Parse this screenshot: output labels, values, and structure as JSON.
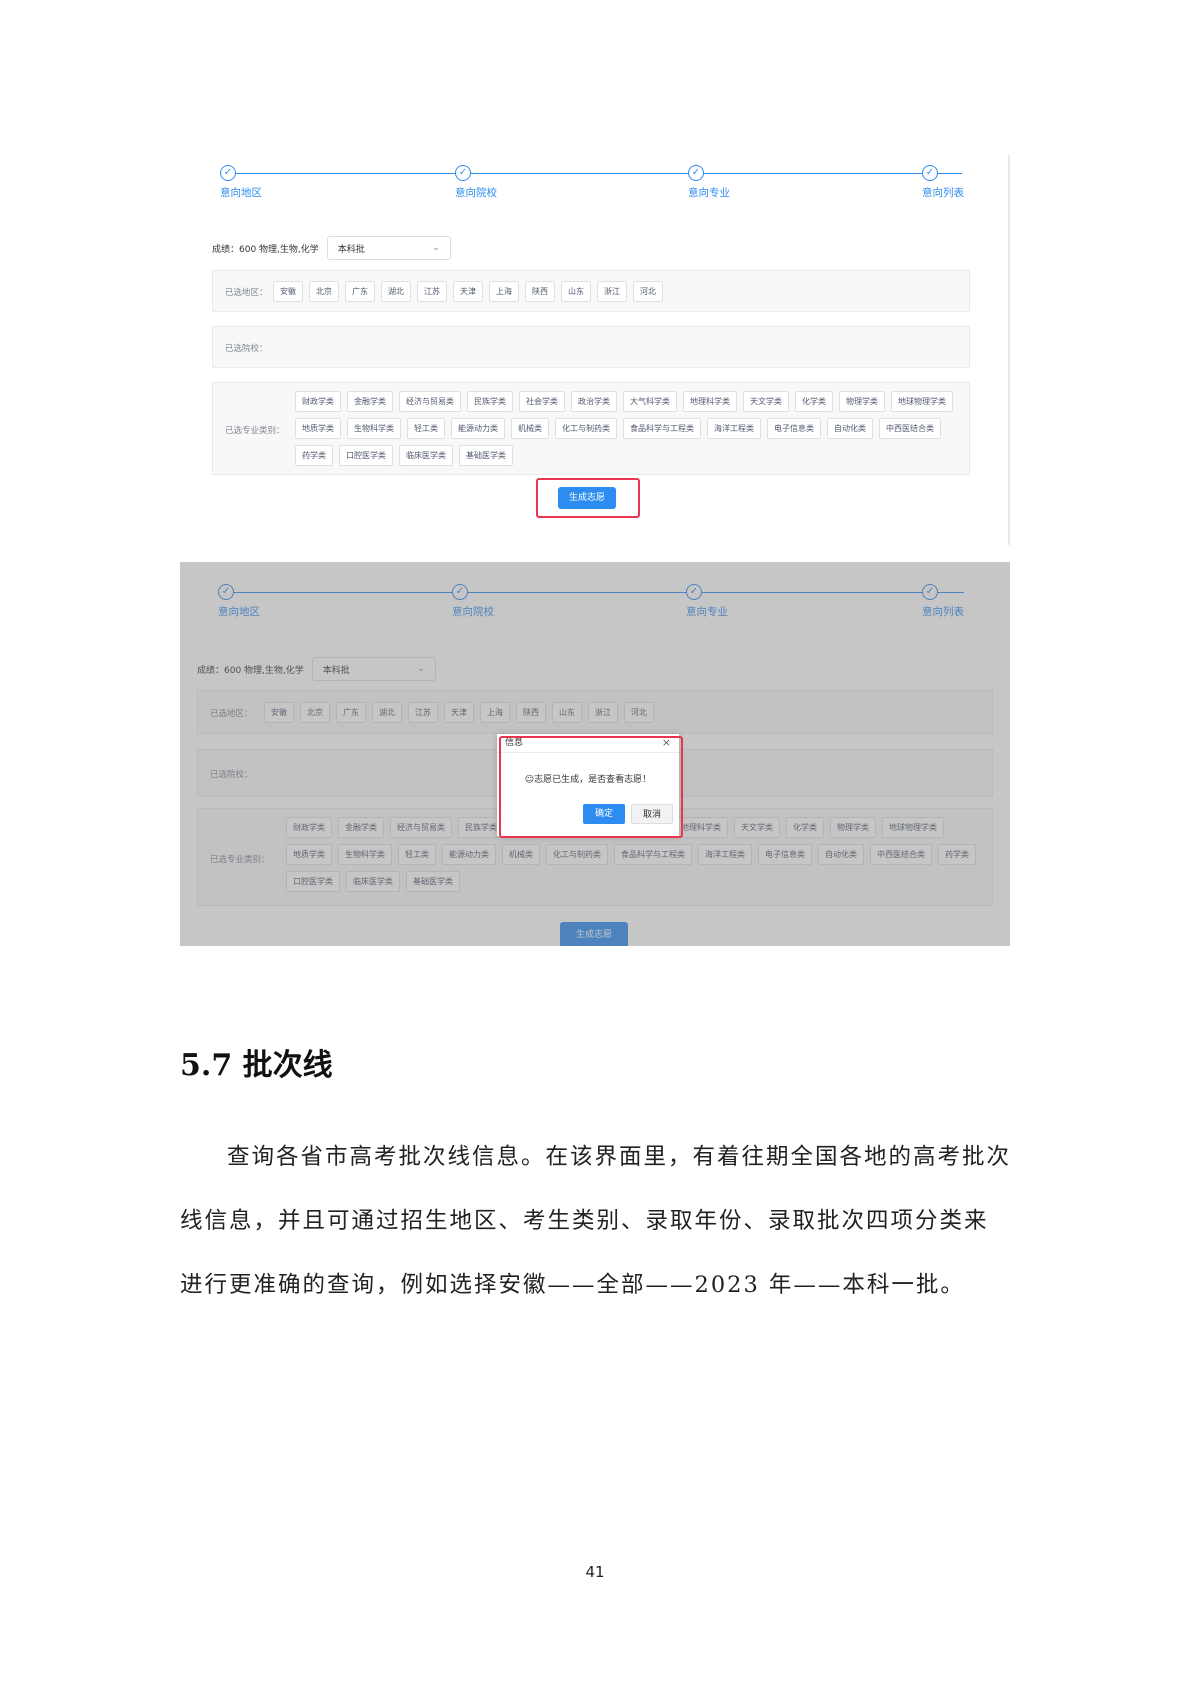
{
  "steps": [
    "意向地区",
    "意向院校",
    "意向专业",
    "意向列表"
  ],
  "score_label": "成绩：600 物理,生物,化学",
  "batch_select": "本科批",
  "region_label": "已选地区：",
  "regions": [
    "安徽",
    "北京",
    "广东",
    "湖北",
    "江苏",
    "天津",
    "上海",
    "陕西",
    "山东",
    "浙江",
    "河北"
  ],
  "school_label": "已选院校：",
  "major_label": "已选专业类别：",
  "majors_row1": [
    "财政学类",
    "金融学类",
    "经济与贸易类",
    "民族学类",
    "社会学类",
    "政治学类",
    "大气科学类",
    "地理科学类",
    "天文学类",
    "化学类",
    "物理学类"
  ],
  "majors_row2": [
    "地球物理学类",
    "地质学类",
    "生物科学类",
    "轻工类",
    "能源动力类",
    "机械类",
    "化工与制药类",
    "食品科学与工程类",
    "海洋工程类",
    "电子信息类",
    "自动化类"
  ],
  "majors_row3": [
    "中西医结合类",
    "药学类",
    "口腔医学类",
    "临床医学类",
    "基础医学类"
  ],
  "generate_button": "生成志愿",
  "dialog": {
    "title": "信息",
    "close": "×",
    "message": "☺志愿已生成，是否查看志愿！",
    "ok": "确定",
    "cancel": "取消"
  },
  "section_heading": "5.7 批次线",
  "paragraph": "查询各省市高考批次线信息。在该界面里，有着往期全国各地的高考批次线信息，并且可通过招生地区、考生类别、录取年份、录取批次四项分类来进行更准确的查询，例如选择安徽——全部——2023 年——本科一批。",
  "page_number": "41"
}
